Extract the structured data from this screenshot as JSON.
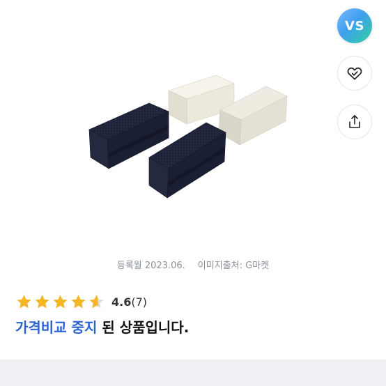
{
  "floating": {
    "vs_label": "VS",
    "wish_icon": "heart-check-icon",
    "share_icon": "share-icon"
  },
  "image_meta": {
    "registered": "등록월 2023.06.",
    "source": "이미지출처: G마켓"
  },
  "rating": {
    "value": 4.6,
    "score_text": "4.6",
    "count_text": "(7)",
    "star_color": "#f5b624"
  },
  "status": {
    "highlight": "가격비교 중지",
    "rest": " 된 상품입니다.",
    "highlight_color": "#2a63d3"
  }
}
